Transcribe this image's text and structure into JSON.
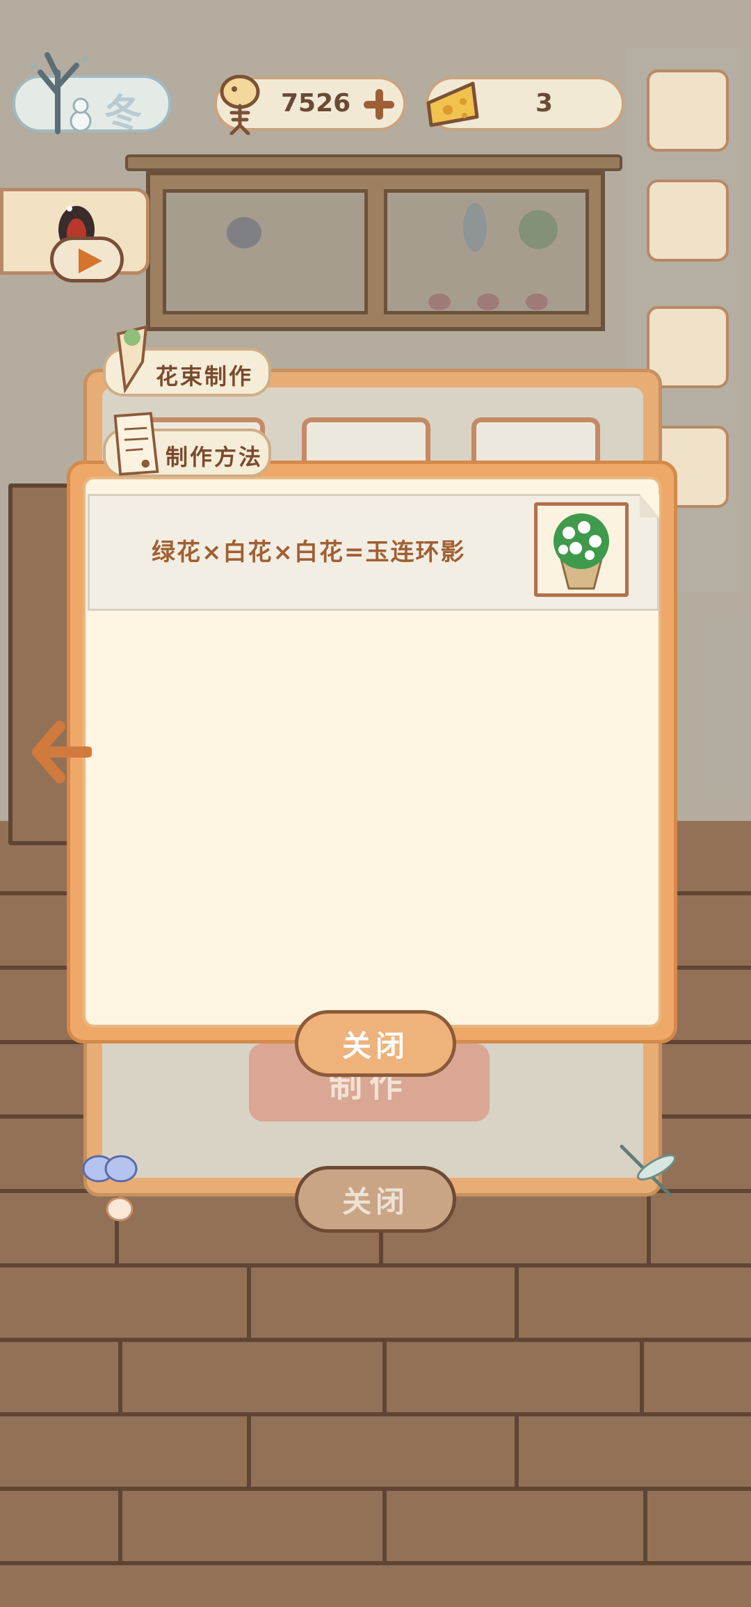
{
  "hud": {
    "season": "冬",
    "fish_count": "7526",
    "cheese_count": "3"
  },
  "back_panel": {
    "tab_title": "花束制作",
    "make_button": "制作",
    "close_button": "关闭"
  },
  "recipe_panel": {
    "tab_title": "制作方法",
    "recipes": [
      {
        "formula": "绿花×白花×白花=玉连环影"
      }
    ],
    "close_button": "关闭"
  },
  "colors": {
    "panel_orange": "#f0a868",
    "panel_cream": "#fdf5e1",
    "text_brown": "#a15f33",
    "accent_plus": "#9f5f36"
  },
  "icons": {
    "season": "snowy-tree-icon",
    "fish": "fish-bone-icon",
    "cheese": "cheese-icon",
    "back": "arrow-left-icon",
    "bouquet": "bouquet-icon"
  }
}
